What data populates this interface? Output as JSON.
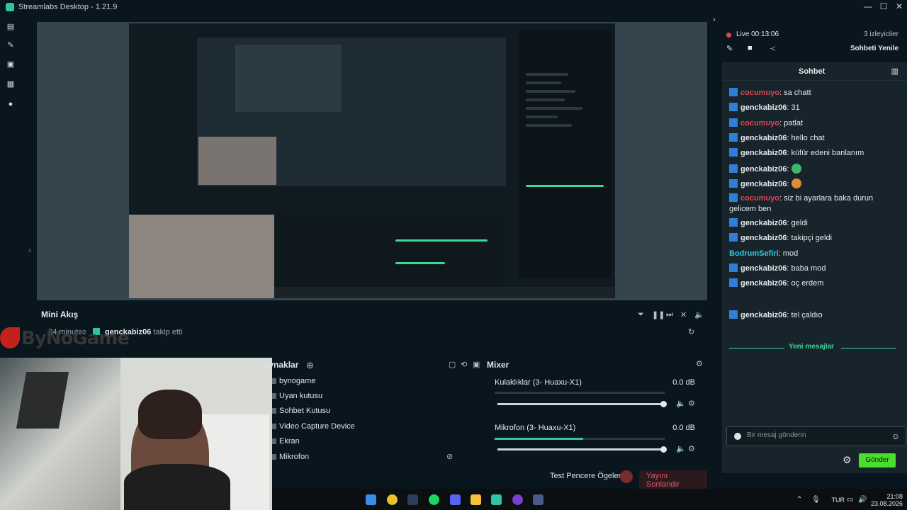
{
  "window": {
    "title": "Streamlabs Desktop - 1.21.9",
    "controls": [
      "—",
      "☐",
      "✕"
    ]
  },
  "nav_icons": [
    "editor-icon",
    "themes-icon",
    "store-icon",
    "studio-icon",
    "live-icon"
  ],
  "mini_feed": {
    "title": "Mini Akış",
    "event": {
      "time": "34 minutes",
      "user": "genckabiz06",
      "action": "takip etti"
    }
  },
  "sources": {
    "title": "Kaynaklar",
    "items": [
      "bynogame",
      "Uyan kutusu",
      "Sohbet Kutusu",
      "Video Capture Device",
      "Ekran",
      "Mikrofon"
    ]
  },
  "mixer": {
    "title": "Mixer",
    "channels": [
      {
        "name": "Kulaklıklar (3- Huaxu-X1)",
        "db": "0.0 dB",
        "level": 0.0
      },
      {
        "name": "Mikrofon (3- Huaxu-X1)",
        "db": "0.0 dB",
        "level": 0.52
      }
    ]
  },
  "footer": {
    "test_label": "Test Pencere Ögeleri",
    "end_label": "Yayını Sonlandır",
    "rec_label": "REC"
  },
  "watermark": "ByNoGame",
  "live": {
    "time": "Live 00:13:06",
    "viewers": "3 izleyiciler",
    "refresh": "Sohbeti Yenile"
  },
  "chat": {
    "title": "Sohbet",
    "messages": [
      {
        "user": "cocumuyo",
        "text": ": sa chatt",
        "color": "#e6424d"
      },
      {
        "user": "genckabiz06",
        "text": ": 31",
        "color": "#e5e9ec"
      },
      {
        "user": "cocumuyo",
        "text": ": patlat",
        "color": "#e6424d"
      },
      {
        "user": "genckabiz06",
        "text": ": hello chat",
        "color": "#e5e9ec"
      },
      {
        "user": "genckabiz06",
        "text": ": küfür edeni banlanım",
        "color": "#e5e9ec"
      },
      {
        "user": "genckabiz06",
        "text": ":",
        "color": "#e5e9ec",
        "emote": "#3db86a"
      },
      {
        "user": "genckabiz06",
        "text": ":",
        "color": "#e5e9ec",
        "emote": "#e08b3a"
      },
      {
        "user": "cocumuyo",
        "text": ": siz bi ayarlara baka durun gelicem ben",
        "color": "#e6424d"
      },
      {
        "user": "genckabiz06",
        "text": ": geldi",
        "color": "#e5e9ec"
      },
      {
        "user": "genckabiz06",
        "text": ": takipçi geldi",
        "color": "#e5e9ec"
      },
      {
        "user": "BodrumSefiri",
        "text": ": mod",
        "color": "#39c3e0",
        "no_badge": true
      },
      {
        "user": "genckabiz06",
        "text": ": baba mod",
        "color": "#e5e9ec"
      },
      {
        "user": "genckabiz06",
        "text": ": oç erdem",
        "color": "#e5e9ec"
      }
    ],
    "new_messages_label": "Yeni mesajlar",
    "after_new": [
      {
        "user": "genckabiz06",
        "text": ": tel çaldıo",
        "color": "#e5e9ec"
      }
    ],
    "input_placeholder": "Bir mesaj gönderin",
    "send_label": "Gönder"
  },
  "taskbar": {
    "lang": "TUR",
    "time": "21:08",
    "date": "23.08.2026"
  }
}
